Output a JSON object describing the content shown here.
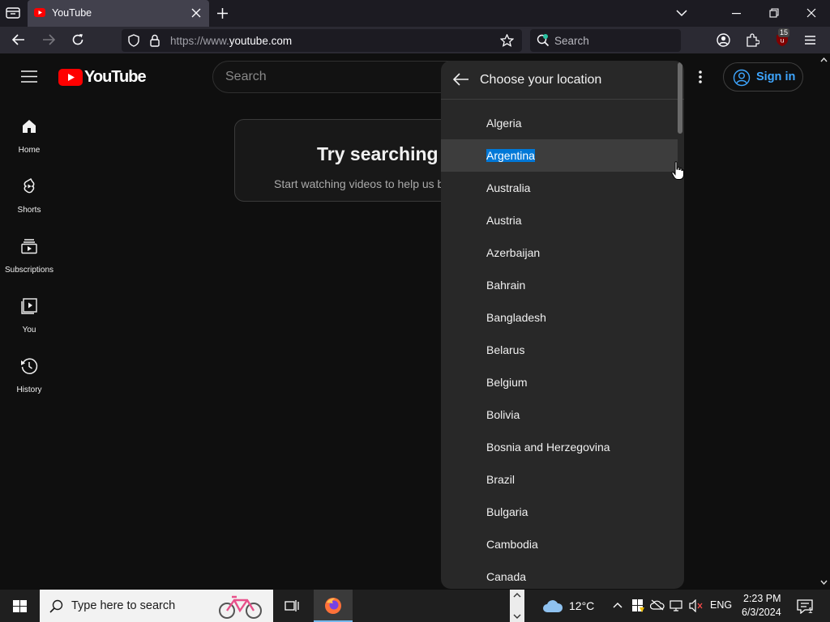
{
  "browser": {
    "tab_title": "YouTube",
    "url_domain": "https://www.",
    "url_host": "youtube.com",
    "search_placeholder": "Search",
    "extension_badge": "15"
  },
  "youtube": {
    "logo_text": "YouTube",
    "search_placeholder": "Search",
    "sidebar": [
      {
        "label": "Home",
        "icon": "home-icon"
      },
      {
        "label": "Shorts",
        "icon": "shorts-icon"
      },
      {
        "label": "Subscriptions",
        "icon": "subscriptions-icon"
      },
      {
        "label": "You",
        "icon": "you-icon"
      },
      {
        "label": "History",
        "icon": "history-icon"
      }
    ],
    "card_title": "Try searching to get started",
    "card_subtitle": "Start watching videos to help us build a feed of videos you'll like.",
    "signin_label": "Sign in"
  },
  "location_menu": {
    "title": "Choose your location",
    "selected": "Argentina",
    "items": [
      "Algeria",
      "Argentina",
      "Australia",
      "Austria",
      "Azerbaijan",
      "Bahrain",
      "Bangladesh",
      "Belarus",
      "Belgium",
      "Bolivia",
      "Bosnia and Herzegovina",
      "Brazil",
      "Bulgaria",
      "Cambodia",
      "Canada"
    ]
  },
  "taskbar": {
    "search_placeholder": "Type here to search",
    "weather": "12°C",
    "language": "ENG",
    "time": "2:23 PM",
    "date": "6/3/2024",
    "notification_count": "1"
  },
  "colors": {
    "yt_red": "#ff0000",
    "link_blue": "#3ea6ff",
    "selection_blue": "#0078d7"
  }
}
